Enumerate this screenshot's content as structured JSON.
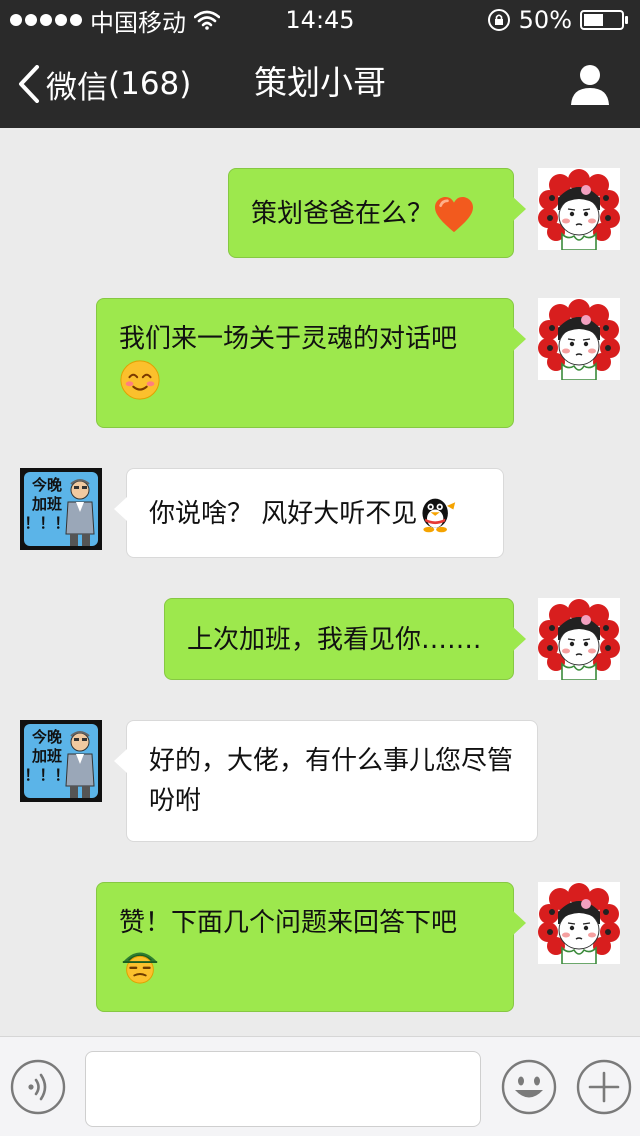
{
  "status_bar": {
    "carrier": "中国移动",
    "time": "14:45",
    "battery": "50%"
  },
  "nav": {
    "back_label": "微信",
    "back_count": "(168)",
    "title": "策划小哥"
  },
  "messages": [
    {
      "side": "self",
      "text": "策划爸爸在么？",
      "emoji": "orange-heart-emoji"
    },
    {
      "side": "self",
      "text": "我们来一场关于灵魂的对话吧",
      "emoji": "smiling-face-emoji"
    },
    {
      "side": "other",
      "text": "你说啥？ 风好大听不见",
      "emoji": "qq-penguin-emoji",
      "avatar_text": [
        "今晚",
        "加班",
        "！！！"
      ]
    },
    {
      "side": "self",
      "text": "上次加班，我看见你……."
    },
    {
      "side": "other",
      "text": "好的，大佬，有什么事儿您尽管吩咐",
      "avatar_text": [
        "今晚",
        "加班",
        "！！！"
      ]
    },
    {
      "side": "self",
      "text": "赞！下面几个问题来回答下吧",
      "emoji": "turtle-emoji"
    }
  ],
  "input": {
    "value": ""
  },
  "icons": {
    "back": "chevron-left-icon",
    "profile": "person-icon",
    "voice": "voice-icon",
    "emoji": "smiley-icon",
    "plus": "plus-icon",
    "wifi": "wifi-icon",
    "lock": "rotation-lock-icon",
    "battery": "battery-icon"
  },
  "colors": {
    "header_bg": "#2a2a2a",
    "chat_bg": "#ebebeb",
    "outgoing_bubble": "#9de84d",
    "incoming_bubble": "#ffffff"
  }
}
